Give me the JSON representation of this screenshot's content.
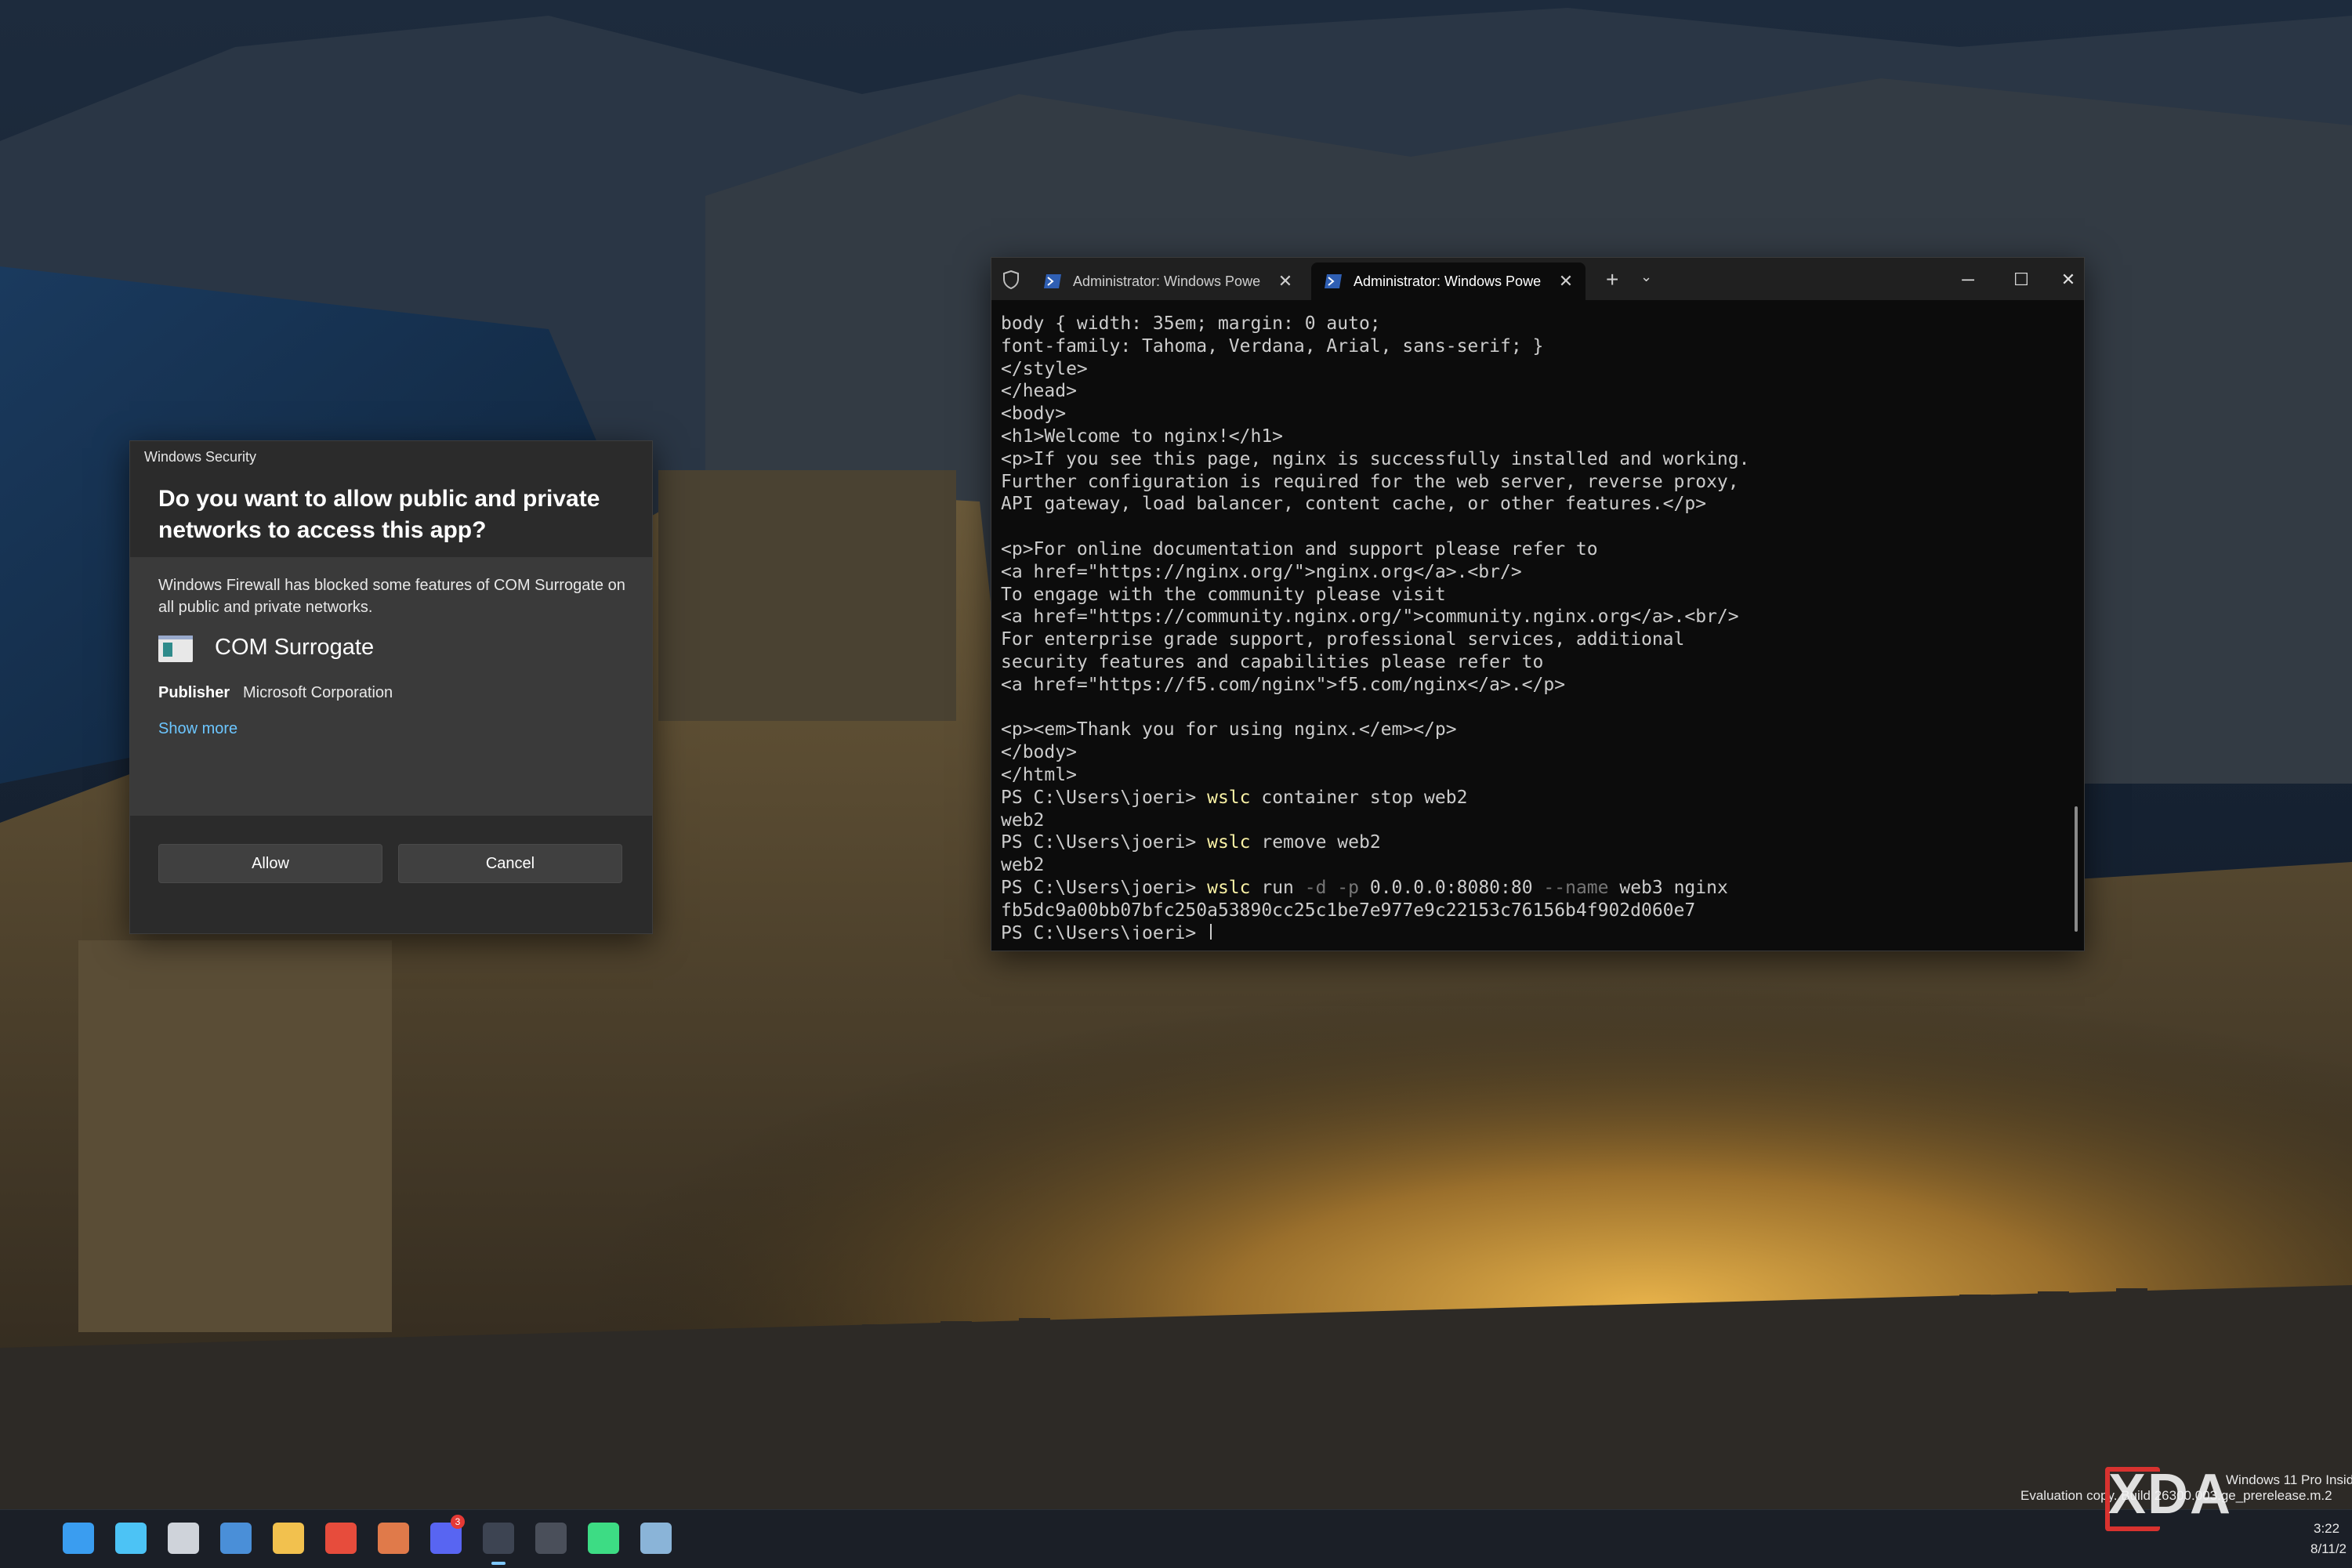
{
  "dialog": {
    "title": "Windows Security",
    "question": "Do you want to allow public and private networks to access this app?",
    "description": "Windows Firewall has blocked some features of COM Surrogate on all public and private networks.",
    "app_name": "COM Surrogate",
    "publisher_label": "Publisher",
    "publisher_value": "Microsoft Corporation",
    "show_more": "Show more",
    "allow_label": "Allow",
    "cancel_label": "Cancel"
  },
  "terminal": {
    "tabs": [
      {
        "label": "Administrator: Windows Powe",
        "active": false
      },
      {
        "label": "Administrator: Windows Powe",
        "active": true
      }
    ],
    "lines": [
      [
        {
          "t": "body { width: 35em; margin: 0 auto;"
        }
      ],
      [
        {
          "t": "font-family: Tahoma, Verdana, Arial, sans-serif; }"
        }
      ],
      [
        {
          "t": "</style>"
        }
      ],
      [
        {
          "t": "</head>"
        }
      ],
      [
        {
          "t": "<body>"
        }
      ],
      [
        {
          "t": "<h1>Welcome to nginx!</h1>"
        }
      ],
      [
        {
          "t": "<p>If you see this page, nginx is successfully installed and working."
        }
      ],
      [
        {
          "t": "Further configuration is required for the web server, reverse proxy,"
        }
      ],
      [
        {
          "t": "API gateway, load balancer, content cache, or other features.</p>"
        }
      ],
      [
        {
          "t": ""
        }
      ],
      [
        {
          "t": "<p>For online documentation and support please refer to"
        }
      ],
      [
        {
          "t": "<a href=\"https://nginx.org/\">nginx.org</a>.<br/>"
        }
      ],
      [
        {
          "t": "To engage with the community please visit"
        }
      ],
      [
        {
          "t": "<a href=\"https://community.nginx.org/\">community.nginx.org</a>.<br/>"
        }
      ],
      [
        {
          "t": "For enterprise grade support, professional services, additional"
        }
      ],
      [
        {
          "t": "security features and capabilities please refer to"
        }
      ],
      [
        {
          "t": "<a href=\"https://f5.com/nginx\">f5.com/nginx</a>.</p>"
        }
      ],
      [
        {
          "t": ""
        }
      ],
      [
        {
          "t": "<p><em>Thank you for using nginx.</em></p>"
        }
      ],
      [
        {
          "t": "</body>"
        }
      ],
      [
        {
          "t": "</html>"
        }
      ],
      [
        {
          "t": "PS C:\\Users\\joeri> "
        },
        {
          "t": "wslc",
          "c": "cmd"
        },
        {
          "t": " container stop web2"
        }
      ],
      [
        {
          "t": "web2"
        }
      ],
      [
        {
          "t": "PS C:\\Users\\joeri> "
        },
        {
          "t": "wslc",
          "c": "cmd"
        },
        {
          "t": " remove web2"
        }
      ],
      [
        {
          "t": "web2"
        }
      ],
      [
        {
          "t": "PS C:\\Users\\joeri> "
        },
        {
          "t": "wslc",
          "c": "cmd"
        },
        {
          "t": " run "
        },
        {
          "t": "-d -p",
          "c": "flag"
        },
        {
          "t": " 0.0.0.0:8080:80 "
        },
        {
          "t": "--name",
          "c": "flag"
        },
        {
          "t": " web3 nginx"
        }
      ],
      [
        {
          "t": "fb5dc9a00bb07bfc250a53890cc25c1be7e977e9c22153c76156b4f902d060e7"
        }
      ],
      [
        {
          "t": "PS C:\\Users\\joeri> "
        }
      ]
    ]
  },
  "taskbar": {
    "icons": [
      "windows-start-icon",
      "search-icon",
      "task-view-icon",
      "photos-icon",
      "file-explorer-icon",
      "chrome-icon",
      "claude-icon",
      "discord-icon",
      "terminal-icon",
      "notepad-icon",
      "android-studio-icon",
      "com-surrogate-icon"
    ],
    "discord_badge": "3",
    "watermark_line1": "Windows 11 Pro Insid",
    "watermark_line2": "Evaluation copy. Build 26300.003.ge_prerelease.m.2",
    "clock_time": "3:22",
    "clock_date": "8/11/2"
  },
  "brand": {
    "logo_text": "XDA",
    "accent": "#d8322f"
  },
  "colors": {
    "link": "#6cc6ff",
    "command": "#f9f1a5",
    "flag": "#767676",
    "terminal_bg": "#0c0c0c"
  }
}
